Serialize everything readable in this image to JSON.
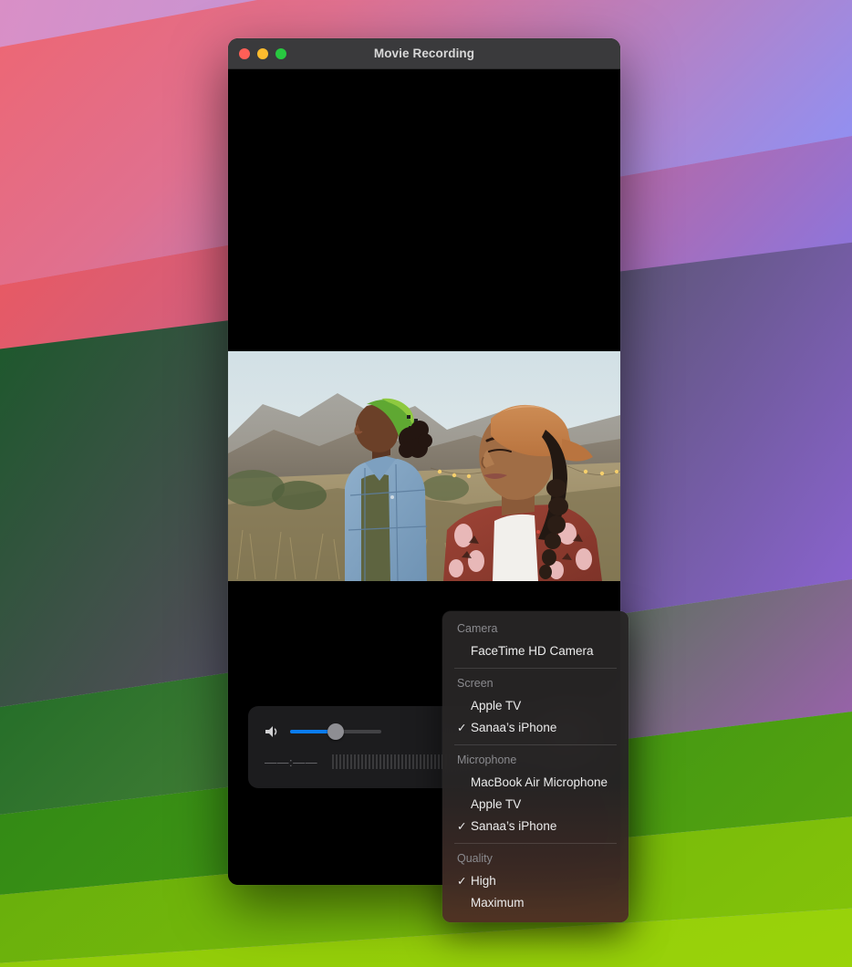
{
  "window": {
    "title": "Movie Recording",
    "traffic_lights": [
      {
        "name": "close",
        "color": "#ff5f57"
      },
      {
        "name": "minimize",
        "color": "#febc2e"
      },
      {
        "name": "zoom",
        "color": "#28c840"
      }
    ]
  },
  "controls": {
    "speaker_icon": "speaker-volume-icon",
    "volume_percent": 50,
    "record_icon": "record-button-icon",
    "timecode": "——:——",
    "audio_meter_bars": 46
  },
  "menu": {
    "sections": [
      {
        "label": "Camera",
        "items": [
          {
            "label": "FaceTime HD Camera",
            "checked": false
          }
        ]
      },
      {
        "label": "Screen",
        "items": [
          {
            "label": "Apple TV",
            "checked": false
          },
          {
            "label": "Sanaa’s iPhone",
            "checked": true
          }
        ]
      },
      {
        "label": "Microphone",
        "items": [
          {
            "label": "MacBook Air Microphone",
            "checked": false
          },
          {
            "label": "Apple TV",
            "checked": false
          },
          {
            "label": "Sanaa’s iPhone",
            "checked": true
          }
        ]
      },
      {
        "label": "Quality",
        "items": [
          {
            "label": "High",
            "checked": true
          },
          {
            "label": "Maximum",
            "checked": false
          }
        ]
      }
    ],
    "check_glyph": "✓"
  },
  "colors": {
    "accent_blue": "#0a7cf0",
    "record_red": "#e8372b",
    "menu_background": "#282626",
    "titlebar": "#3a3a3c",
    "control_bar": "#1c1c1e"
  },
  "wallpaper": {
    "name": "macos-sonoma-stripes",
    "bands": [
      "#c79ad6",
      "#cf8fbe",
      "#f25f60",
      "#f0564f",
      "#ef5745",
      "#e2543b",
      "#0a5a1e",
      "#176b1f",
      "#3f9213",
      "#64ab0d",
      "#85c408",
      "#9ace0a"
    ],
    "right_bands": [
      "#96a3f7",
      "#8b9bf8",
      "#6f6ef2",
      "#7b5ae8",
      "#b06ec4"
    ]
  },
  "video": {
    "description": "Two people walking outdoors at dusk in hilly scrubland with string lights",
    "letterbox_color": "#000000"
  }
}
